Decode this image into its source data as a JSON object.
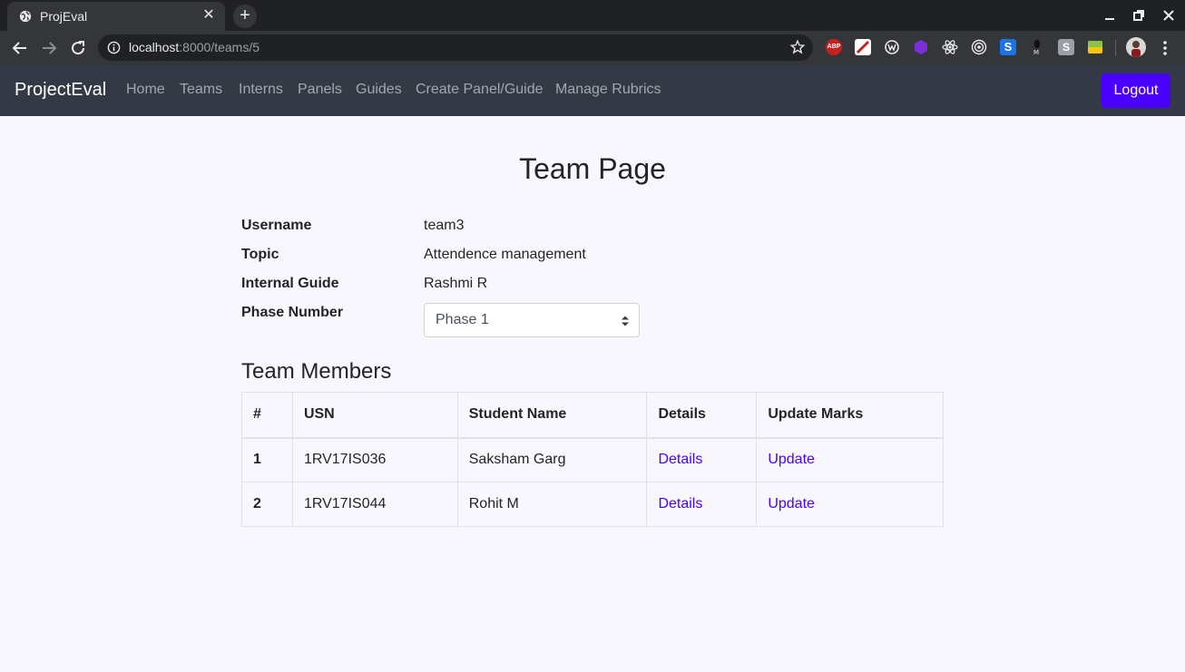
{
  "browser": {
    "tab_title": "ProjEval",
    "url_host": "localhost",
    "url_rest": ":8000/teams/5"
  },
  "navbar": {
    "brand": "ProjectEval",
    "links": [
      "Home",
      "Teams",
      "Interns",
      "Panels",
      "Guides",
      "Create Panel/Guide",
      "Manage Rubrics"
    ],
    "logout": "Logout"
  },
  "page": {
    "title": "Team Page",
    "info": [
      {
        "label": "Username",
        "value": "team3"
      },
      {
        "label": "Topic",
        "value": "Attendence management"
      },
      {
        "label": "Internal Guide",
        "value": "Rashmi R"
      }
    ],
    "phase_label": "Phase Number",
    "phase_selected": "Phase 1",
    "members_title": "Team Members",
    "table": {
      "headers": [
        "#",
        "USN",
        "Student Name",
        "Details",
        "Update Marks"
      ],
      "rows": [
        {
          "num": "1",
          "usn": "1RV17IS036",
          "name": "Saksham Garg",
          "details": "Details",
          "update": "Update"
        },
        {
          "num": "2",
          "usn": "1RV17IS044",
          "name": "Rohit M",
          "details": "Details",
          "update": "Update"
        }
      ]
    }
  },
  "colors": {
    "accent": "#4a00ff",
    "navbar_bg": "#343a45",
    "page_bg": "#f8f7fd"
  }
}
